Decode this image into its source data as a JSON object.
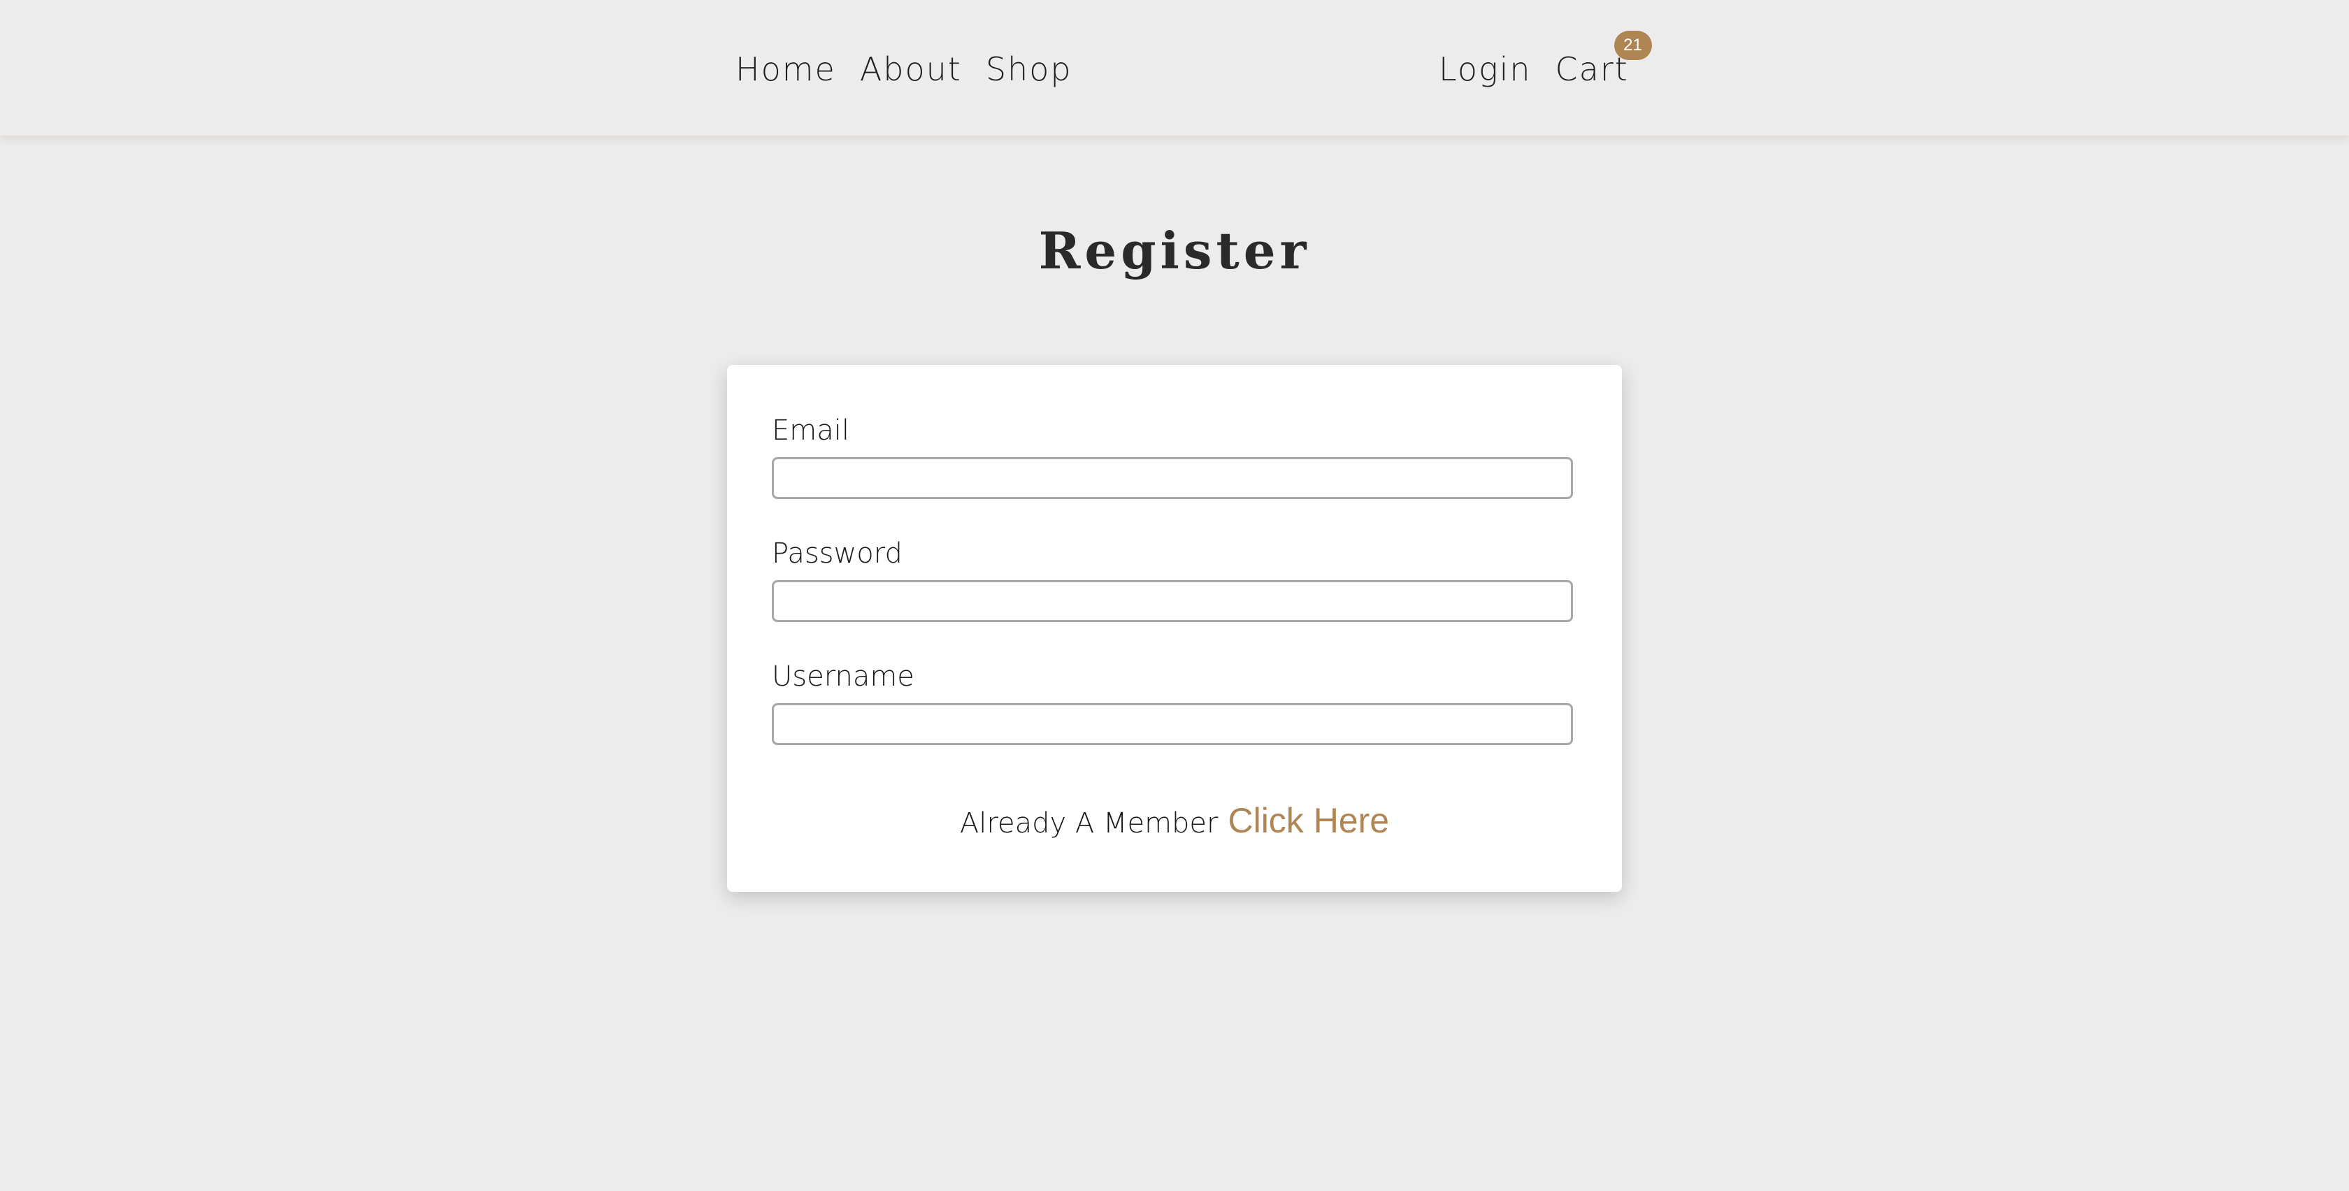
{
  "nav": {
    "left": [
      {
        "label": "Home"
      },
      {
        "label": "About"
      },
      {
        "label": "Shop"
      }
    ],
    "login": "Login",
    "cart": "Cart",
    "cart_count": "21"
  },
  "page": {
    "title": "Register"
  },
  "form": {
    "email_label": "Email",
    "email_value": "",
    "password_label": "Password",
    "password_value": "",
    "username_label": "Username",
    "username_value": "",
    "member_text": "Already A Member",
    "member_link": "Click Here"
  },
  "colors": {
    "background": "#ececec",
    "accent": "#b08554",
    "card": "#ffffff"
  }
}
